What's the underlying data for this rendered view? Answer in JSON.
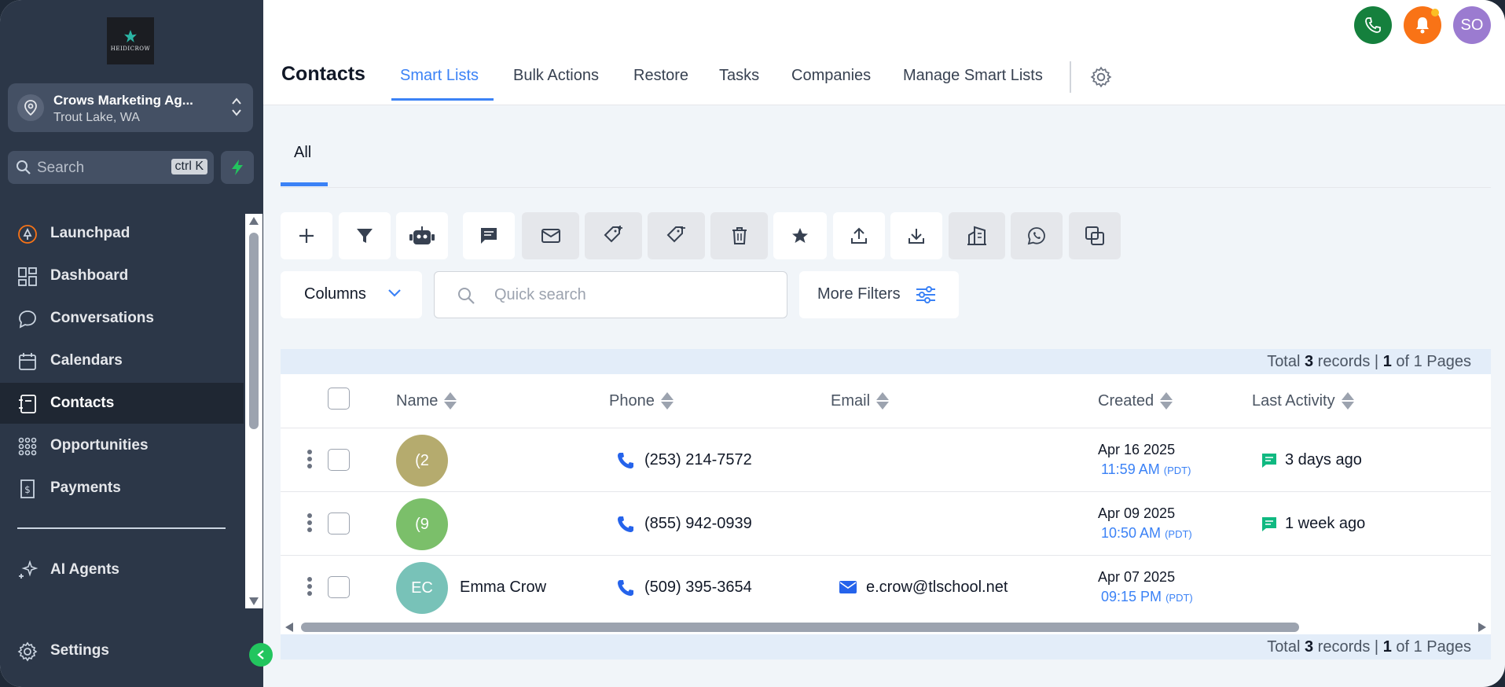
{
  "logo": {
    "text": "HEIDICROW"
  },
  "account": {
    "name": "Crows Marketing Ag...",
    "location": "Trout Lake, WA"
  },
  "search": {
    "placeholder": "Search",
    "shortcut": "ctrl K"
  },
  "sidebar": {
    "items": [
      {
        "label": "Launchpad",
        "icon": "rocket-icon"
      },
      {
        "label": "Dashboard",
        "icon": "grid-icon"
      },
      {
        "label": "Conversations",
        "icon": "chat-bubble-icon"
      },
      {
        "label": "Calendars",
        "icon": "calendar-icon"
      },
      {
        "label": "Contacts",
        "icon": "contact-book-icon",
        "active": true
      },
      {
        "label": "Opportunities",
        "icon": "funnel-icon"
      },
      {
        "label": "Payments",
        "icon": "receipt-icon"
      },
      {
        "label": "AI Agents",
        "icon": "sparkle-icon"
      }
    ],
    "settings_label": "Settings"
  },
  "header": {
    "title": "Contacts",
    "tabs": [
      {
        "label": "Smart Lists",
        "active": true
      },
      {
        "label": "Bulk Actions"
      },
      {
        "label": "Restore"
      },
      {
        "label": "Tasks"
      },
      {
        "label": "Companies"
      },
      {
        "label": "Manage Smart Lists"
      }
    ],
    "avatar_initials": "SO"
  },
  "subtabs": [
    "All"
  ],
  "toolbar": {
    "icons": [
      "add-icon",
      "filter-icon",
      "bot-icon",
      "message-icon",
      "email-icon",
      "add-tag-icon",
      "remove-tag-icon",
      "delete-icon",
      "star-icon",
      "upload-icon",
      "download-icon",
      "building-icon",
      "whatsapp-icon",
      "merge-icon"
    ]
  },
  "controls": {
    "columns_label": "Columns",
    "quick_search_placeholder": "Quick search",
    "more_filters_label": "More Filters"
  },
  "records": {
    "prefix": "Total ",
    "count": "3",
    "middle": " records | ",
    "page": "1",
    "suffix": " of 1 Pages"
  },
  "table": {
    "columns": [
      "Name",
      "Phone",
      "Email",
      "Created",
      "Last Activity"
    ],
    "rows": [
      {
        "initials": "(2",
        "avatar_color": "#b5ab6e",
        "name": "",
        "phone": "(253) 214-7572",
        "email": "",
        "created_date": "Apr 16 2025",
        "created_time": "11:59 AM",
        "tz": "(PDT)",
        "last_activity": "3 days ago"
      },
      {
        "initials": "(9",
        "avatar_color": "#7bbf6a",
        "name": "",
        "phone": "(855) 942-0939",
        "email": "",
        "created_date": "Apr 09 2025",
        "created_time": "10:50 AM",
        "tz": "(PDT)",
        "last_activity": "1 week ago"
      },
      {
        "initials": "EC",
        "avatar_color": "#78c2b8",
        "name": "Emma Crow",
        "phone": "(509) 395-3654",
        "email": "e.crow@tlschool.net",
        "created_date": "Apr 07 2025",
        "created_time": "09:15 PM",
        "tz": "(PDT)",
        "last_activity": ""
      }
    ]
  },
  "colors": {
    "accent": "#3b82f6",
    "sidebar": "#2c3748",
    "phone_btn": "#15803d",
    "notif_btn": "#f97316",
    "avatar_btn": "#9b7bd0"
  }
}
